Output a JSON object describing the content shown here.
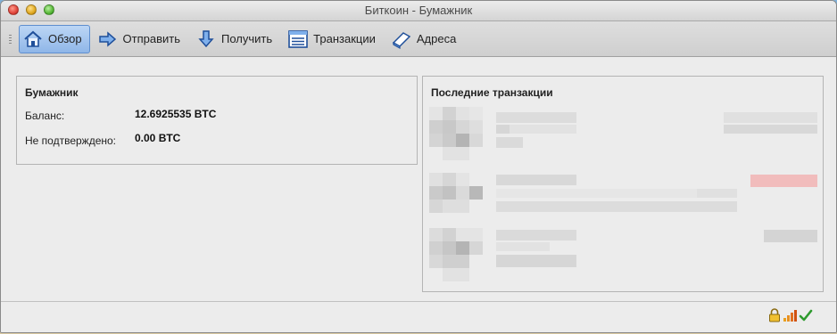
{
  "window": {
    "title": "Биткоин - Бумажник"
  },
  "toolbar": {
    "items": [
      {
        "label": "Обзор",
        "icon": "home-icon",
        "active": true
      },
      {
        "label": "Отправить",
        "icon": "send-arrow-icon",
        "active": false
      },
      {
        "label": "Получить",
        "icon": "receive-arrow-icon",
        "active": false
      },
      {
        "label": "Транзакции",
        "icon": "transactions-list-icon",
        "active": false
      },
      {
        "label": "Адреса",
        "icon": "address-book-icon",
        "active": false
      }
    ]
  },
  "wallet": {
    "title": "Бумажник",
    "balance_label": "Баланс:",
    "balance_value": "12.6925535 BTC",
    "unconfirmed_label": "Не подтверждено:",
    "unconfirmed_value": "0.00 BTC"
  },
  "recent": {
    "title": "Последние транзакции"
  },
  "status": {
    "icons": [
      "lock-icon",
      "connection-signal-icon",
      "synced-check-icon"
    ]
  },
  "colors": {
    "active_button": "#9dc0ec",
    "pink_amount": "#f3b8b8"
  }
}
